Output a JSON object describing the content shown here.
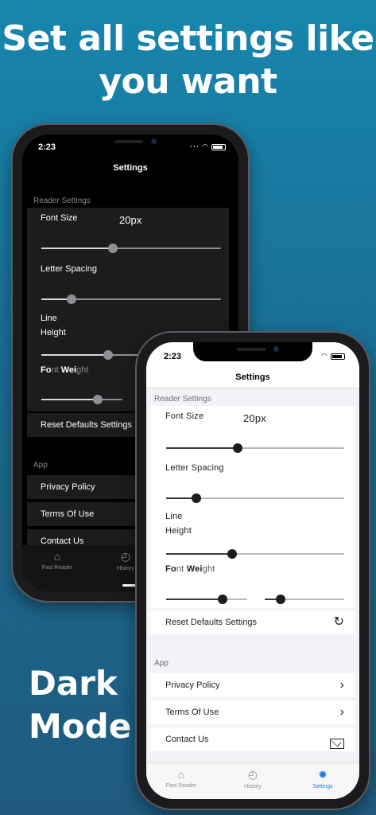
{
  "headline": "Set all settings like you want",
  "dark_caption": "Dark Mode",
  "status": {
    "time": "2:23"
  },
  "screen": {
    "title": "Settings",
    "reader_section": "Reader Settings",
    "font_size_label": "Font Size",
    "font_size_value": "20px",
    "letter_spacing_label": "Letter Spacing",
    "line_height_label": "Line Height",
    "font_weight_label": {
      "p1": "Fo",
      "p2": "nt ",
      "p3": "Wei",
      "p4": "ght"
    },
    "reset_label": "Reset Defaults Settings",
    "app_section": "App",
    "privacy_label": "Privacy Policy",
    "terms_label": "Terms Of Use",
    "contact_label": "Contact Us"
  },
  "sliders": {
    "font_size": 0.4,
    "letter_spacing": 0.17,
    "line_height": 0.37,
    "font_weight_a": 0.7,
    "font_weight_b": 0.2
  },
  "tabs": [
    {
      "label": "Fast Reader",
      "icon": "home-icon"
    },
    {
      "label": "History",
      "icon": "history-icon"
    },
    {
      "label": "Settings",
      "icon": "gear-icon",
      "active": true
    }
  ],
  "colors": {
    "accent": "#1b7ef1",
    "background_top": "#1786ad",
    "background_bottom": "#1f5a7e"
  }
}
